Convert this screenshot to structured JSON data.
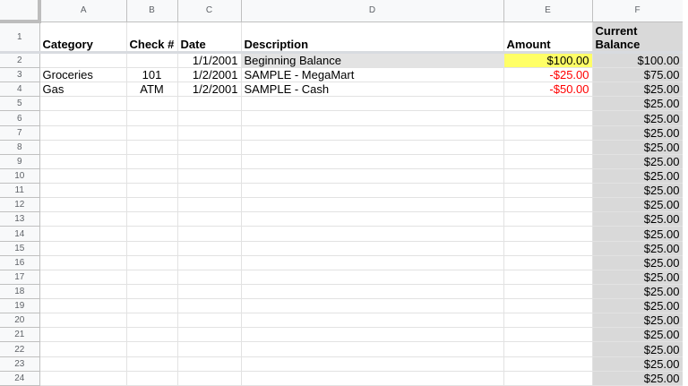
{
  "columns": [
    "A",
    "B",
    "C",
    "D",
    "E",
    "F"
  ],
  "row_numbers": [
    "1",
    "2",
    "3",
    "4",
    "5",
    "6",
    "7",
    "8",
    "9",
    "10",
    "11",
    "12",
    "13",
    "14",
    "15",
    "16",
    "17",
    "18",
    "19",
    "20",
    "21",
    "22",
    "23",
    "24"
  ],
  "header": {
    "category": "Category",
    "check": "Check #",
    "date": "Date",
    "description": "Description",
    "amount": "Amount",
    "balance_line1": "Current",
    "balance_line2": "Balance"
  },
  "rows": [
    {
      "category": "",
      "check": "",
      "date": "1/1/2001",
      "description": "Beginning Balance",
      "amount": "$100.00",
      "balance": "$100.00"
    },
    {
      "category": "Groceries",
      "check": "101",
      "date": "1/2/2001",
      "description": "SAMPLE - MegaMart",
      "amount": "-$25.00",
      "balance": "$75.00"
    },
    {
      "category": "Gas",
      "check": "ATM",
      "date": "1/2/2001",
      "description": "SAMPLE - Cash",
      "amount": "-$50.00",
      "balance": "$25.00"
    },
    {
      "category": "",
      "check": "",
      "date": "",
      "description": "",
      "amount": "",
      "balance": "$25.00"
    },
    {
      "category": "",
      "check": "",
      "date": "",
      "description": "",
      "amount": "",
      "balance": "$25.00"
    },
    {
      "category": "",
      "check": "",
      "date": "",
      "description": "",
      "amount": "",
      "balance": "$25.00"
    },
    {
      "category": "",
      "check": "",
      "date": "",
      "description": "",
      "amount": "",
      "balance": "$25.00"
    },
    {
      "category": "",
      "check": "",
      "date": "",
      "description": "",
      "amount": "",
      "balance": "$25.00"
    },
    {
      "category": "",
      "check": "",
      "date": "",
      "description": "",
      "amount": "",
      "balance": "$25.00"
    },
    {
      "category": "",
      "check": "",
      "date": "",
      "description": "",
      "amount": "",
      "balance": "$25.00"
    },
    {
      "category": "",
      "check": "",
      "date": "",
      "description": "",
      "amount": "",
      "balance": "$25.00"
    },
    {
      "category": "",
      "check": "",
      "date": "",
      "description": "",
      "amount": "",
      "balance": "$25.00"
    },
    {
      "category": "",
      "check": "",
      "date": "",
      "description": "",
      "amount": "",
      "balance": "$25.00"
    },
    {
      "category": "",
      "check": "",
      "date": "",
      "description": "",
      "amount": "",
      "balance": "$25.00"
    },
    {
      "category": "",
      "check": "",
      "date": "",
      "description": "",
      "amount": "",
      "balance": "$25.00"
    },
    {
      "category": "",
      "check": "",
      "date": "",
      "description": "",
      "amount": "",
      "balance": "$25.00"
    },
    {
      "category": "",
      "check": "",
      "date": "",
      "description": "",
      "amount": "",
      "balance": "$25.00"
    },
    {
      "category": "",
      "check": "",
      "date": "",
      "description": "",
      "amount": "",
      "balance": "$25.00"
    },
    {
      "category": "",
      "check": "",
      "date": "",
      "description": "",
      "amount": "",
      "balance": "$25.00"
    },
    {
      "category": "",
      "check": "",
      "date": "",
      "description": "",
      "amount": "",
      "balance": "$25.00"
    },
    {
      "category": "",
      "check": "",
      "date": "",
      "description": "",
      "amount": "",
      "balance": "$25.00"
    },
    {
      "category": "",
      "check": "",
      "date": "",
      "description": "",
      "amount": "",
      "balance": "$25.00"
    },
    {
      "category": "",
      "check": "",
      "date": "",
      "description": "",
      "amount": "",
      "balance": "$25.00"
    }
  ],
  "colors": {
    "highlight_yellow": "#ffff66",
    "negative_red": "#ff0000",
    "balance_column_grey": "#d9d9d9"
  }
}
